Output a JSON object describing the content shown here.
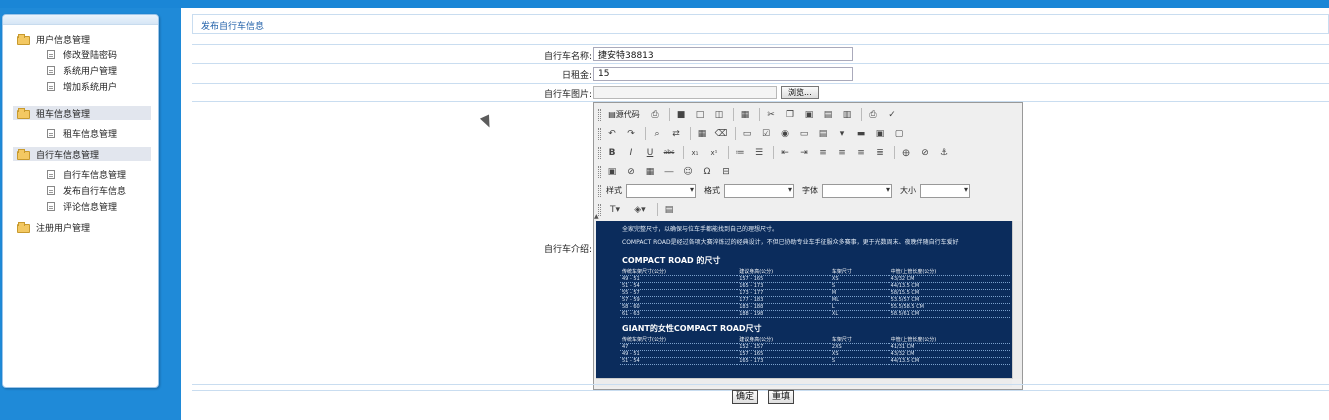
{
  "sidebar": {
    "groups": [
      {
        "label": "用户信息管理",
        "active": false,
        "items": [
          "修改登陆密码",
          "系统用户管理",
          "增加系统用户"
        ]
      },
      {
        "label": "租车信息管理",
        "active": true,
        "items": [
          "租车信息管理"
        ]
      },
      {
        "label": "自行车信息管理",
        "active": true,
        "items": [
          "自行车信息管理",
          "发布自行车信息",
          "评论信息管理"
        ]
      },
      {
        "label": "注册用户管理",
        "active": false,
        "items": []
      }
    ]
  },
  "main": {
    "title": "发布自行车信息",
    "form": {
      "name_label": "自行车名称:",
      "name_value": "捷安特38813",
      "rent_label": "日租金:",
      "rent_value": "15",
      "image_label": "自行车图片:",
      "browse_label": "浏览...",
      "intro_label": "自行车介绍:"
    },
    "editor": {
      "source_label": "源代码",
      "style_label": "样式",
      "format_label": "格式",
      "font_label": "字体",
      "size_label": "大小",
      "content": {
        "intro_line1": "全家完整尺寸，以确保与位车手都能找到自己的理想尺寸。",
        "intro_line2": "COMPACT ROAD是经过各项大赛淬炼过的经典设计，不但已协助专业车手征服众多赛事，更于光数周末、夜晚伴随自行车爱好",
        "table1_title": "COMPACT ROAD 的尺寸",
        "table2_title": "GIANT的女性COMPACT ROAD尺寸",
        "headers": [
          "传统车架尺寸(公分)",
          "建议身高(公分)",
          "车架尺寸",
          "中管/上管长度(公分)"
        ],
        "table1_rows": [
          [
            "49 - 51",
            "157 - 165",
            "XS",
            "43/32 CM"
          ],
          [
            "51 - 54",
            "165 - 173",
            "S",
            "44/13.5 CM"
          ],
          [
            "55 - 57",
            "173 - 177",
            "M",
            "58/15.5 CM"
          ],
          [
            "57 - 59",
            "177 - 183",
            "ML",
            "53.5/57 CM"
          ],
          [
            "58 - 60",
            "183 - 188",
            "L",
            "55.5/58.5 CM"
          ],
          [
            "61 - 63",
            "188 - 198",
            "XL",
            "58.5/61 CM"
          ]
        ],
        "table2_rows": [
          [
            "47",
            "152 - 157",
            "2XS",
            "41/31 CM"
          ],
          [
            "49 - 51",
            "157 - 165",
            "XS",
            "43/32 CM"
          ],
          [
            "51 - 54",
            "165 - 173",
            "S",
            "44/13.5 CM"
          ]
        ]
      }
    },
    "buttons": {
      "submit_label": "确定",
      "reset_label": "重填"
    }
  }
}
